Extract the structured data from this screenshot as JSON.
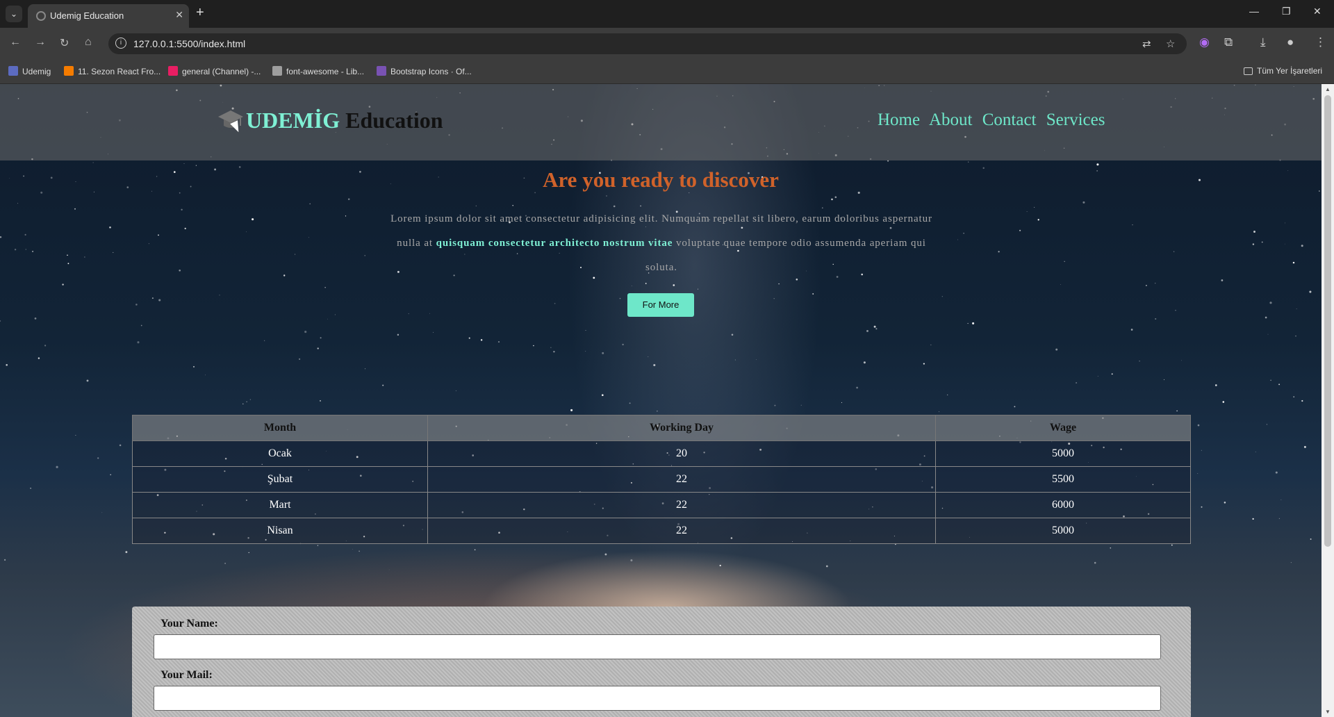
{
  "browser": {
    "tab_title": "Udemig Education",
    "tab_close": "✕",
    "new_tab": "+",
    "url": "127.0.0.1:5500/index.html",
    "bookmarks": [
      {
        "label": "Udemig",
        "icon": "udemig-icon",
        "color": "#5c6bc0"
      },
      {
        "label": "11. Sezon React Fro...",
        "icon": "folder-icon",
        "color": "#f57c00"
      },
      {
        "label": "general (Channel) -...",
        "icon": "slack-icon",
        "color": "#e91e63"
      },
      {
        "label": "font-awesome - Lib...",
        "icon": "code-icon",
        "color": "#9e9e9e"
      },
      {
        "label": "Bootstrap Icons · Of...",
        "icon": "bootstrap-icon",
        "color": "#7952b3"
      }
    ],
    "all_bookmarks": "Tüm Yer İşaretleri"
  },
  "site": {
    "logo_part1": "UDEMİG",
    "logo_part2": " Education",
    "logo_icon": "graduation-cap-icon",
    "nav": [
      "Home",
      "About",
      "Contact",
      "Services"
    ],
    "accent": "#6ee7c9",
    "hero_title": "Are you ready to discover",
    "hero_text_before": "Lorem ipsum dolor sit amet consectetur adipisicing elit. Numquam repellat sit libero, earum doloribus aspernatur nulla at ",
    "hero_text_highlight": "quisquam consectetur architecto nostrum vitae",
    "hero_text_after": " voluptate quae tempore odio assumenda aperiam qui soluta.",
    "button": "For More"
  },
  "table": {
    "headers": [
      "Month",
      "Working Day",
      "Wage"
    ],
    "rows": [
      [
        "Ocak",
        "20",
        "5000"
      ],
      [
        "Şubat",
        "22",
        "5500"
      ],
      [
        "Mart",
        "22",
        "6000"
      ],
      [
        "Nisan",
        "22",
        "5000"
      ]
    ]
  },
  "form": {
    "name_label": "Your Name:",
    "mail_label": "Your Mail:"
  }
}
